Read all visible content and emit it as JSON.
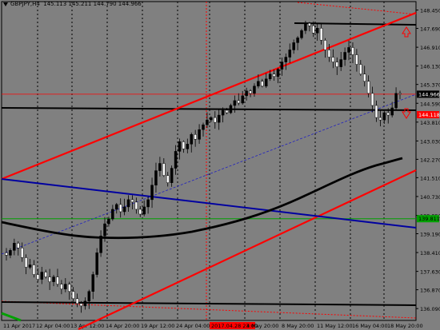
{
  "header": {
    "symbol": "GBPJPY,H4",
    "ohlc": "145.113 145.211 144.790 144.966"
  },
  "chart_data": {
    "type": "candlestick",
    "ylim": [
      135.6,
      148.8
    ],
    "y_ticks": [
      "148.450",
      "147.690",
      "146.910",
      "146.130",
      "145.370",
      "144.590",
      "143.810",
      "143.030",
      "142.270",
      "141.510",
      "140.730",
      "139.950",
      "139.190",
      "138.410",
      "137.630",
      "136.870",
      "136.090"
    ],
    "x_ticks": [
      "11 Apr 2017",
      "12 Apr 04:00",
      "13 Apr 12:00",
      "14 Apr 20:00",
      "19 Apr 12:00",
      "24 Apr 04:00",
      "2017.04.28 23:00",
      "4 May 20:00",
      "8 May 20:00",
      "11 May 12:00",
      "16 May 04:00",
      "18 May 20:00"
    ],
    "highlighted_x_tick": "2017.04.28 23:00",
    "price_labels": [
      {
        "text": "144.966",
        "value": 144.966,
        "color": "#000000",
        "text_color": "#ffffff"
      },
      {
        "text": "144.118",
        "value": 144.118,
        "color": "#ff0000",
        "text_color": "#ffffff"
      },
      {
        "text": "139.811",
        "value": 139.811,
        "color": "#00a000",
        "text_color": "#000000"
      }
    ],
    "candles_close": [
      138.3,
      138.5,
      138.8,
      138.6,
      138.2,
      137.8,
      137.9,
      137.5,
      137.3,
      137.6,
      137.4,
      137.2,
      137.4,
      137.1,
      136.9,
      137.1,
      136.8,
      136.5,
      136.3,
      136.2,
      136.4,
      136.8,
      137.5,
      138.4,
      139.1,
      139.6,
      139.8,
      140.2,
      140.4,
      140.1,
      140.3,
      140.6,
      140.5,
      140.2,
      140.0,
      140.3,
      140.6,
      141.2,
      141.8,
      142.1,
      141.6,
      141.3,
      141.9,
      142.6,
      143.0,
      142.7,
      142.9,
      143.3,
      143.1,
      143.5,
      143.7,
      143.9,
      144.0,
      143.8,
      144.1,
      144.3,
      144.2,
      144.5,
      144.7,
      144.6,
      144.9,
      145.1,
      145.0,
      145.3,
      145.5,
      145.3,
      145.6,
      145.8,
      145.7,
      146.0,
      146.3,
      146.5,
      146.8,
      147.1,
      147.3,
      147.6,
      147.9,
      147.8,
      147.5,
      147.7,
      147.2,
      146.8,
      146.5,
      146.3,
      146.1,
      146.4,
      146.7,
      146.9,
      146.6,
      146.2,
      145.8,
      145.5,
      145.0,
      144.5,
      144.0,
      143.9,
      144.2,
      144.1,
      144.4,
      145.0,
      144.966
    ],
    "bullish_color": "#000000",
    "bearish_color": "#ffffff",
    "lines": [
      {
        "name": "upper-channel-line",
        "color": "#ff0000",
        "width": 2,
        "style": "solid"
      },
      {
        "name": "lower-channel-line",
        "color": "#ff0000",
        "width": 2,
        "style": "solid"
      },
      {
        "name": "mid-channel-line",
        "color": "#2020c0",
        "width": 1,
        "style": "dashed"
      },
      {
        "name": "blue-trend-line",
        "color": "#0000a0",
        "width": 2,
        "style": "solid"
      },
      {
        "name": "resistance-line",
        "color": "#000000",
        "width": 2,
        "style": "solid"
      },
      {
        "name": "support-line",
        "color": "#000000",
        "width": 2,
        "style": "solid"
      },
      {
        "name": "top-resistance-line",
        "color": "#000000",
        "width": 2,
        "style": "solid"
      },
      {
        "name": "moving-average",
        "color": "#000000",
        "width": 3,
        "style": "solid"
      },
      {
        "name": "green-level-line",
        "color": "#00a000",
        "width": 1,
        "style": "solid"
      },
      {
        "name": "red-level-line",
        "color": "#ff0000",
        "width": 1,
        "style": "solid"
      },
      {
        "name": "red-dotted-line",
        "color": "#ff0000",
        "width": 1,
        "style": "dotted"
      }
    ],
    "arrows": [
      {
        "name": "up-arrow-icon",
        "color": "#ff0000",
        "direction": "up"
      },
      {
        "name": "down-arrow-icon",
        "color": "#ff0000",
        "direction": "down"
      }
    ],
    "grid": true
  }
}
